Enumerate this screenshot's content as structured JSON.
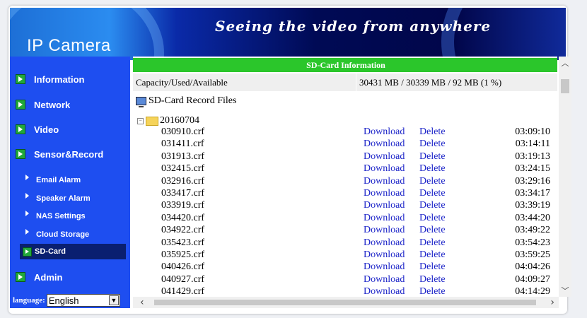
{
  "banner": {
    "brand": "IP Camera",
    "slogan": "Seeing the video from anywhere"
  },
  "sidebar": {
    "items": [
      {
        "label": "Information"
      },
      {
        "label": "Network"
      },
      {
        "label": "Video"
      },
      {
        "label": "Sensor&Record"
      }
    ],
    "subitems": [
      {
        "label": "Email Alarm"
      },
      {
        "label": "Speaker Alarm"
      },
      {
        "label": "NAS Settings"
      },
      {
        "label": "Cloud Storage"
      },
      {
        "label": "SD-Card"
      }
    ],
    "admin_label": "Admin",
    "language_label": "language:",
    "language_value": "English"
  },
  "content": {
    "header": "SD-Card Information",
    "capacity_label": "Capacity/Used/Available",
    "capacity_value": "30431 MB / 30339 MB / 92 MB (1 %)",
    "record_title": "SD-Card Record Files",
    "folder": "20160704",
    "download_label": "Download",
    "delete_label": "Delete",
    "files": [
      {
        "name": "030910.crf",
        "time": "03:09:10"
      },
      {
        "name": "031411.crf",
        "time": "03:14:11"
      },
      {
        "name": "031913.crf",
        "time": "03:19:13"
      },
      {
        "name": "032415.crf",
        "time": "03:24:15"
      },
      {
        "name": "032916.crf",
        "time": "03:29:16"
      },
      {
        "name": "033417.crf",
        "time": "03:34:17"
      },
      {
        "name": "033919.crf",
        "time": "03:39:19"
      },
      {
        "name": "034420.crf",
        "time": "03:44:20"
      },
      {
        "name": "034922.crf",
        "time": "03:49:22"
      },
      {
        "name": "035423.crf",
        "time": "03:54:23"
      },
      {
        "name": "035925.crf",
        "time": "03:59:25"
      },
      {
        "name": "040426.crf",
        "time": "04:04:26"
      },
      {
        "name": "040927.crf",
        "time": "04:09:27"
      },
      {
        "name": "041429.crf",
        "time": "04:14:29"
      }
    ]
  },
  "icons": {
    "nav": "green-arrow-square-icon",
    "record": "computer-icon",
    "folder": "folder-icon"
  }
}
